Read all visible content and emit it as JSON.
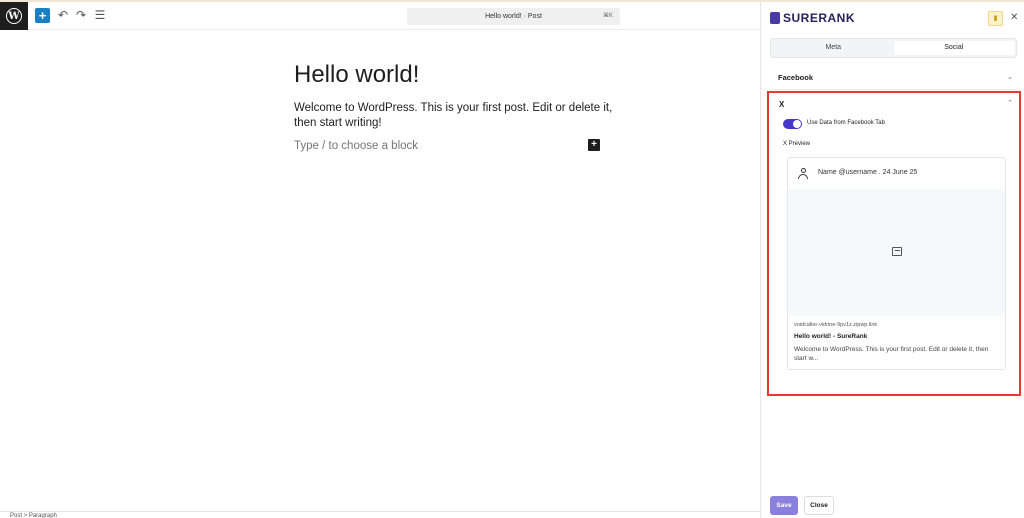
{
  "editor": {
    "doc_title": "Hello world! · Post",
    "doc_shortcut": "⌘K",
    "post_title": "Hello world!",
    "paragraph": "Welcome to WordPress. This is your first post. Edit or delete it, then start writing!",
    "placeholder": "Type / to choose a block",
    "breadcrumb": "Post  >  Paragraph"
  },
  "sidebar": {
    "brand": "SURERANK",
    "tabs": [
      {
        "label": "Meta",
        "active": false
      },
      {
        "label": "Social",
        "active": true
      }
    ],
    "facebook_label": "Facebook",
    "x_label": "X",
    "toggle_label": "Use Data from Facebook Tab",
    "toggle_on": true,
    "preview_label": "X Preview",
    "card": {
      "user": "Name @username . 24 June 25",
      "domain": "voidcaller-vidrine-9pv1z.zipwp.link",
      "title": "Hello world! - SureRank",
      "description": "Welcome to WordPress. This is your first post. Edit or delete it, then start w..."
    },
    "save_label": "Save",
    "close_label": "Close"
  },
  "colors": {
    "accent": "#4338ca",
    "wp_blue": "#1c7ec3",
    "highlight": "#e53a2f"
  }
}
